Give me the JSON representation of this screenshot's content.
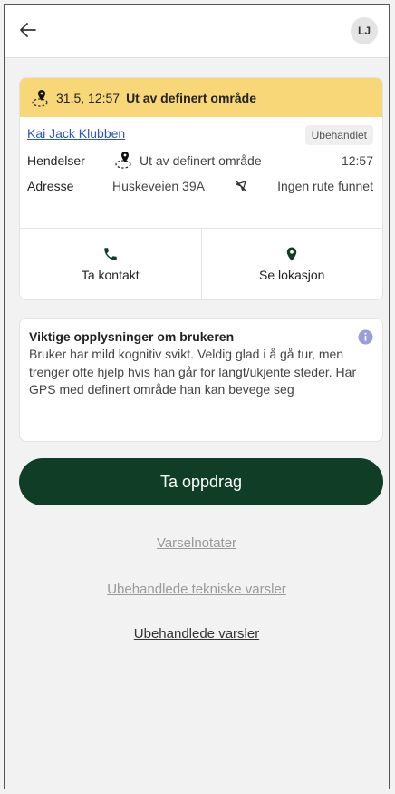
{
  "header": {
    "back_icon": "arrow-left-icon",
    "avatar_initials": "LJ"
  },
  "alert": {
    "date_time": "31.5, 12:57",
    "title": "Ut av definert område",
    "banner_color": "#f7d777",
    "user_link": "Kai Jack Klubben",
    "status_badge": "Ubehandlet",
    "events_label": "Hendelser",
    "event_text": "Ut av definert område",
    "event_time": "12:57",
    "address_label": "Adresse",
    "address_value": "Huskeveien 39A",
    "route_status": "Ingen rute funnet",
    "actions": {
      "contact": "Ta kontakt",
      "location": "Se lokasjon"
    }
  },
  "info": {
    "title": "Viktige opplysninger om brukeren",
    "text": "Bruker har mild kognitiv svikt. Veldig glad i å gå tur, men trenger ofte hjelp hvis han går for langt/ukjente steder. Har GPS med definert område han kan bevege seg"
  },
  "primary_button": "Ta oppdrag",
  "primary_color": "#0f3d26",
  "links": {
    "notes": "Varselnotater",
    "technical": "Ubehandlede tekniske varsler",
    "unhandled": "Ubehandlede varsler"
  }
}
